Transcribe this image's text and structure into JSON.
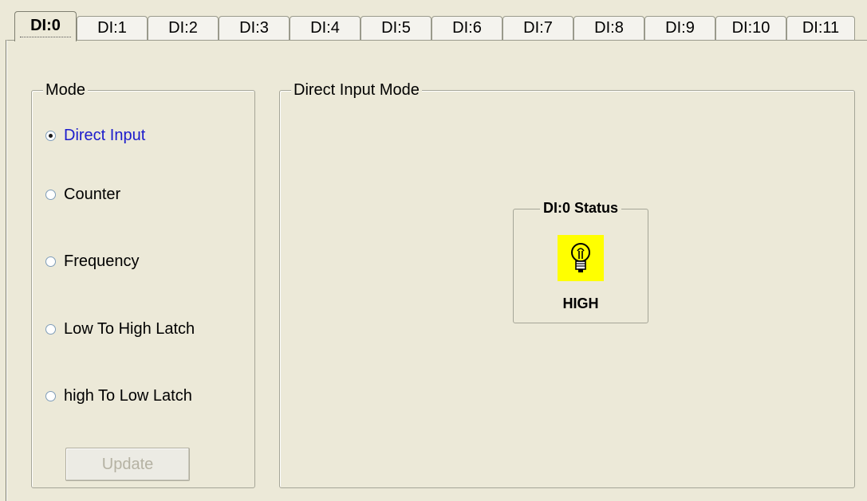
{
  "tabs": [
    {
      "label": "DI:0",
      "active": true
    },
    {
      "label": "DI:1"
    },
    {
      "label": "DI:2"
    },
    {
      "label": "DI:3"
    },
    {
      "label": "DI:4"
    },
    {
      "label": "DI:5"
    },
    {
      "label": "DI:6"
    },
    {
      "label": "DI:7"
    },
    {
      "label": "DI:8"
    },
    {
      "label": "DI:9"
    },
    {
      "label": "DI:10"
    },
    {
      "label": "DI:11"
    }
  ],
  "mode": {
    "title": "Mode",
    "options": [
      {
        "label": "Direct Input",
        "checked": true
      },
      {
        "label": "Counter",
        "checked": false
      },
      {
        "label": "Frequency",
        "checked": false
      },
      {
        "label": "Low To High Latch",
        "checked": false
      },
      {
        "label": "high To Low Latch",
        "checked": false
      }
    ],
    "update_label": "Update"
  },
  "direct": {
    "title": "Direct Input Mode",
    "status_title": "DI:0 Status",
    "status_value": "HIGH",
    "indicator_icon": "lightbulb-icon",
    "indicator_color": "#ffff00"
  }
}
